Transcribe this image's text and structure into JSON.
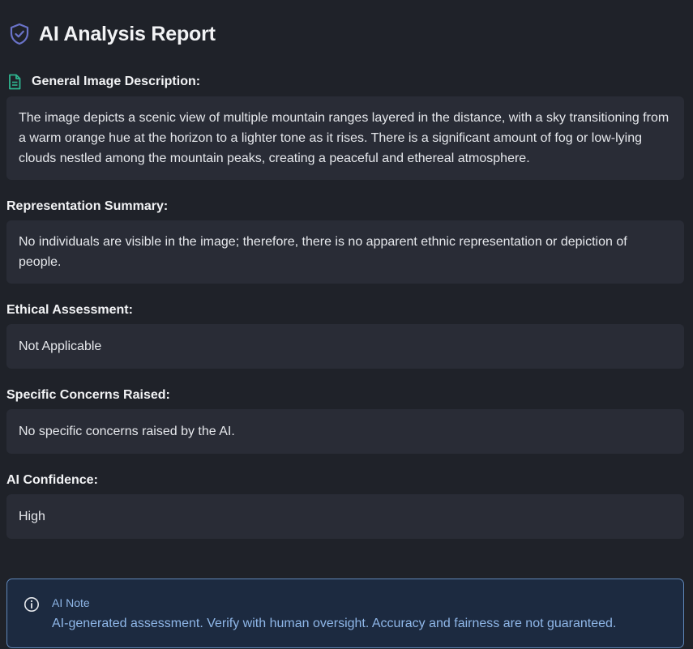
{
  "header": {
    "title": "AI Analysis Report",
    "icon": "shield-check-icon",
    "icon_color": "#6a73c9"
  },
  "sections": {
    "description": {
      "title": "General Image Description:",
      "icon": "document-icon",
      "icon_color": "#2fb58f",
      "text": "The image depicts a scenic view of multiple mountain ranges layered in the distance, with a sky transitioning from a warm orange hue at the horizon to a lighter tone as it rises. There is a significant amount of fog or low-lying clouds nestled among the mountain peaks, creating a peaceful and ethereal atmosphere."
    },
    "representation": {
      "title": "Representation Summary:",
      "text": "No individuals are visible in the image; therefore, there is no apparent ethnic representation or depiction of people."
    },
    "ethical": {
      "title": "Ethical Assessment:",
      "text": "Not Applicable"
    },
    "concerns": {
      "title": "Specific Concerns Raised:",
      "text": "No specific concerns raised by the AI."
    },
    "confidence": {
      "title": "AI Confidence:",
      "text": "High"
    }
  },
  "note": {
    "icon": "info-icon",
    "label": "AI Note",
    "text": "AI-generated assessment. Verify with human oversight. Accuracy and fairness are not guaranteed.",
    "accent": "#8fb7e8"
  }
}
